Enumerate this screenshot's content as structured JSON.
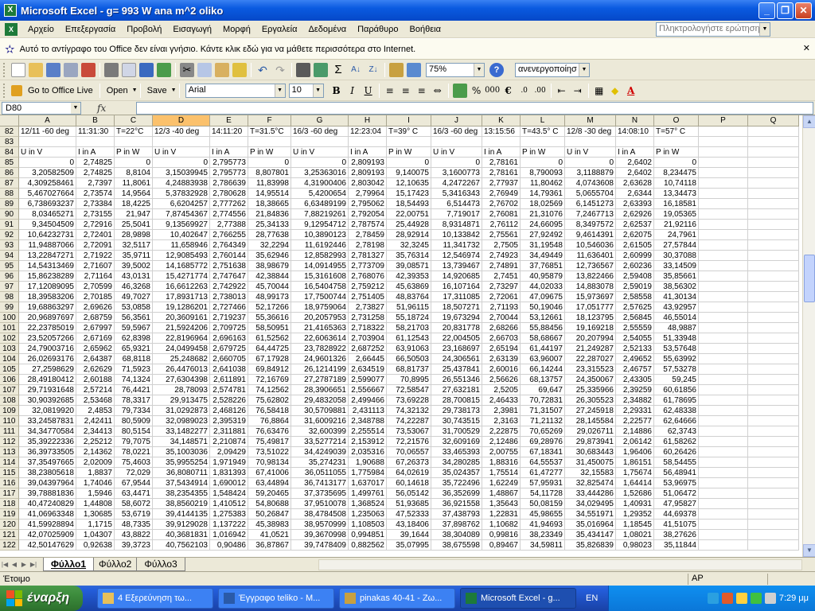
{
  "window": {
    "title": "Microsoft Excel - g= 993 W ana m^2 oliko",
    "min": "_",
    "max": "❐",
    "close": "✕"
  },
  "menu": {
    "items": [
      "Αρχείο",
      "Επεξεργασία",
      "Προβολή",
      "Εισαγωγή",
      "Μορφή",
      "Εργαλεία",
      "Δεδομένα",
      "Παράθυρο",
      "Βοήθεια"
    ],
    "question_placeholder": "Πληκτρολογήστε ερώτηση"
  },
  "infobar": {
    "text": "Αυτό το αντίγραφο του Office δεν είναι γνήσιο. Κάντε κλικ εδώ για να μάθετε περισσότερα στο Internet."
  },
  "toolbar": {
    "zoom": "75%",
    "state": "ανενεργοποίησ",
    "font": "Arial",
    "size": "10",
    "go_office": "Go to Office Live",
    "open": "Open",
    "save": "Save"
  },
  "formula": {
    "namebox": "D80",
    "fx": "fx"
  },
  "grid": {
    "columns": [
      "A",
      "B",
      "C",
      "D",
      "E",
      "F",
      "G",
      "H",
      "I",
      "J",
      "K",
      "L",
      "M",
      "N",
      "O",
      "P",
      "Q"
    ],
    "selected_column": "D",
    "rows": [
      {
        "n": "82",
        "c": [
          "12/11 -60 deg",
          "11:31:30",
          "T=22°C",
          "12/3 -40 deg",
          "14:11:20",
          "T=31.5°C",
          "16/3 -60 deg",
          "12:23:04",
          "T=39° C",
          "16/3 -60 deg",
          "13:15:56",
          "T=43.5° C",
          "12/8 -30 deg",
          "14:08:10",
          "T=57° C",
          "",
          ""
        ]
      },
      {
        "n": "83",
        "c": [
          "",
          "",
          "",
          "",
          "",
          "",
          "",
          "",
          "",
          "",
          "",
          "",
          "",
          "",
          "",
          "",
          ""
        ]
      },
      {
        "n": "84",
        "c": [
          "U in V",
          "I in A",
          "P in W",
          "U in V",
          "I in A",
          "P in W",
          "U in V",
          "I in A",
          "P in W",
          "U in V",
          "I in A",
          "P in W",
          "U in V",
          "I in A",
          "P in W",
          "",
          ""
        ]
      },
      {
        "n": "85",
        "c": [
          "0",
          "2,74825",
          "0",
          "0",
          "2,795773",
          "0",
          "0",
          "2,809193",
          "0",
          "0",
          "2,78161",
          "0",
          "0",
          "2,6402",
          "0",
          "",
          ""
        ]
      },
      {
        "n": "86",
        "c": [
          "3,20582509",
          "2,74825",
          "8,8104",
          "3,15039945",
          "2,795773",
          "8,807801",
          "3,25363016",
          "2,809193",
          "9,140075",
          "3,1600773",
          "2,78161",
          "8,790093",
          "3,1188879",
          "2,6402",
          "8,234475",
          "",
          ""
        ]
      },
      {
        "n": "87",
        "c": [
          "4,309258461",
          "2,7397",
          "11,8061",
          "4,24883938",
          "2,786639",
          "11,83998",
          "4,31900406",
          "2,803042",
          "12,10635",
          "4,2472267",
          "2,77937",
          "11,80462",
          "4,0743608",
          "2,63628",
          "10,74118",
          "",
          ""
        ]
      },
      {
        "n": "88",
        "c": [
          "5,467027664",
          "2,73574",
          "14,9564",
          "5,37832928",
          "2,780628",
          "14,95514",
          "5,4200654",
          "2,79964",
          "15,17423",
          "5,3416343",
          "2,76949",
          "14,79361",
          "5,0655704",
          "2,6344",
          "13,34473",
          "",
          ""
        ]
      },
      {
        "n": "89",
        "c": [
          "6,738693237",
          "2,73384",
          "18,4225",
          "6,6204257",
          "2,777262",
          "18,38665",
          "6,63489199",
          "2,795062",
          "18,54493",
          "6,514473",
          "2,76702",
          "18,02569",
          "6,1451273",
          "2,63393",
          "16,18581",
          "",
          ""
        ]
      },
      {
        "n": "90",
        "c": [
          "8,03465271",
          "2,73155",
          "21,947",
          "7,87454367",
          "2,774556",
          "21,84836",
          "7,88219261",
          "2,792054",
          "22,00751",
          "7,719017",
          "2,76081",
          "21,31076",
          "7,2467713",
          "2,62926",
          "19,05365",
          "",
          ""
        ]
      },
      {
        "n": "91",
        "c": [
          "9,34504509",
          "2,72916",
          "25,5041",
          "9,13569927",
          "2,77388",
          "25,34133",
          "9,12954712",
          "2,787574",
          "25,44928",
          "8,9314871",
          "2,76112",
          "24,66095",
          "8,3497572",
          "2,62537",
          "21,92116",
          "",
          ""
        ]
      },
      {
        "n": "92",
        "c": [
          "10,64232731",
          "2,72401",
          "28,9898",
          "10,402647",
          "2,766255",
          "28,77638",
          "10,3890123",
          "2,78459",
          "28,92914",
          "10,133842",
          "2,75561",
          "27,92492",
          "9,4614391",
          "2,62075",
          "24,7961",
          "",
          ""
        ]
      },
      {
        "n": "93",
        "c": [
          "11,94887066",
          "2,72091",
          "32,5117",
          "11,658946",
          "2,764349",
          "32,2294",
          "11,6192446",
          "2,78198",
          "32,3245",
          "11,341732",
          "2,7505",
          "31,19548",
          "10,546036",
          "2,61505",
          "27,57844",
          "",
          ""
        ]
      },
      {
        "n": "94",
        "c": [
          "13,22847271",
          "2,71922",
          "35,9711",
          "12,9085493",
          "2,760144",
          "35,62946",
          "12,8582993",
          "2,781327",
          "35,76314",
          "12,546974",
          "2,74923",
          "34,49449",
          "11,636401",
          "2,60999",
          "30,37088",
          "",
          ""
        ]
      },
      {
        "n": "95",
        "c": [
          "14,54313469",
          "2,71607",
          "39,5002",
          "14,1685772",
          "2,751638",
          "38,98679",
          "14,0914955",
          "2,773709",
          "39,08571",
          "13,739467",
          "2,74891",
          "37,76851",
          "12,736567",
          "2,60236",
          "33,14509",
          "",
          ""
        ]
      },
      {
        "n": "96",
        "c": [
          "15,86238289",
          "2,71164",
          "43,0131",
          "15,4271774",
          "2,747647",
          "42,38844",
          "15,3161608",
          "2,768076",
          "42,39353",
          "14,920685",
          "2,7451",
          "40,95879",
          "13,822466",
          "2,59408",
          "35,85661",
          "",
          ""
        ]
      },
      {
        "n": "97",
        "c": [
          "17,12089095",
          "2,70599",
          "46,3268",
          "16,6612263",
          "2,742922",
          "45,70044",
          "16,5404758",
          "2,759212",
          "45,63869",
          "16,107164",
          "2,73297",
          "44,02033",
          "14,883078",
          "2,59019",
          "38,56302",
          "",
          ""
        ]
      },
      {
        "n": "98",
        "c": [
          "18,39583206",
          "2,70185",
          "49,7027",
          "17,8931713",
          "2,738013",
          "48,99173",
          "17,7500744",
          "2,751405",
          "48,83764",
          "17,311085",
          "2,72061",
          "47,09675",
          "15,973697",
          "2,58558",
          "41,30134",
          "",
          ""
        ]
      },
      {
        "n": "99",
        "c": [
          "19,68863297",
          "2,69626",
          "53,0858",
          "19,1286201",
          "2,727466",
          "52,17266",
          "18,9759064",
          "2,73827",
          "51,96115",
          "18,507271",
          "2,71193",
          "50,19046",
          "17,051777",
          "2,57625",
          "43,92957",
          "",
          ""
        ]
      },
      {
        "n": "100",
        "c": [
          "20,96897697",
          "2,68759",
          "56,3561",
          "20,3609161",
          "2,719237",
          "55,36616",
          "20,2057953",
          "2,731258",
          "55,18724",
          "19,673294",
          "2,70044",
          "53,12661",
          "18,123795",
          "2,56845",
          "46,55014",
          "",
          ""
        ]
      },
      {
        "n": "101",
        "c": [
          "22,23785019",
          "2,67997",
          "59,5967",
          "21,5924206",
          "2,709725",
          "58,50951",
          "21,4165363",
          "2,718322",
          "58,21703",
          "20,831778",
          "2,68266",
          "55,88456",
          "19,169218",
          "2,55559",
          "48,9887",
          "",
          ""
        ]
      },
      {
        "n": "102",
        "c": [
          "23,52057266",
          "2,67169",
          "62,8398",
          "22,8196964",
          "2,696163",
          "61,52562",
          "22,6063614",
          "2,703904",
          "61,12543",
          "22,004505",
          "2,66703",
          "58,68667",
          "20,207994",
          "2,54055",
          "51,33948",
          "",
          ""
        ]
      },
      {
        "n": "103",
        "c": [
          "24,79003716",
          "2,65962",
          "65,9321",
          "24,0499458",
          "2,679725",
          "64,44725",
          "23,7828922",
          "2,687252",
          "63,91063",
          "23,168697",
          "2,65194",
          "61,44197",
          "21,249287",
          "2,52133",
          "53,57648",
          "",
          ""
        ]
      },
      {
        "n": "104",
        "c": [
          "26,02693176",
          "2,64387",
          "68,8118",
          "25,248682",
          "2,660705",
          "67,17928",
          "24,9601326",
          "2,66445",
          "66,50503",
          "24,306561",
          "2,63139",
          "63,96007",
          "22,287027",
          "2,49652",
          "55,63992",
          "",
          ""
        ]
      },
      {
        "n": "105",
        "c": [
          "27,2598629",
          "2,62629",
          "71,5923",
          "26,4476013",
          "2,641038",
          "69,84912",
          "26,1214199",
          "2,634519",
          "68,81737",
          "25,437841",
          "2,60016",
          "66,14244",
          "23,315523",
          "2,46757",
          "57,53278",
          "",
          ""
        ]
      },
      {
        "n": "106",
        "c": [
          "28,49180412",
          "2,60188",
          "74,1324",
          "27,6304398",
          "2,611891",
          "72,16769",
          "27,2787189",
          "2,599077",
          "70,8995",
          "26,551346",
          "2,56626",
          "68,13757",
          "24,350067",
          "2,43305",
          "59,245",
          "",
          ""
        ]
      },
      {
        "n": "107",
        "c": [
          "29,71931648",
          "2,57214",
          "76,4421",
          "28,78093",
          "2,574781",
          "74,12562",
          "28,3906651",
          "2,556667",
          "72,58547",
          "27,632181",
          "2,5205",
          "69,647",
          "25,335966",
          "2,39259",
          "60,61856",
          "",
          ""
        ]
      },
      {
        "n": "108",
        "c": [
          "30,90392685",
          "2,53468",
          "78,3317",
          "29,913475",
          "2,528226",
          "75,62802",
          "29,4832058",
          "2,499466",
          "73,69228",
          "28,700815",
          "2,46433",
          "70,72831",
          "26,305523",
          "2,34882",
          "61,78695",
          "",
          ""
        ]
      },
      {
        "n": "109",
        "c": [
          "32,0819920",
          "2,4853",
          "79,7334",
          "31,0292873",
          "2,468126",
          "76,58418",
          "30,5709881",
          "2,431113",
          "74,32132",
          "29,738173",
          "2,3981",
          "71,31507",
          "27,245918",
          "2,29331",
          "62,48338",
          "",
          ""
        ]
      },
      {
        "n": "110",
        "c": [
          "33,24587831",
          "2,42411",
          "80,5909",
          "32,0989023",
          "2,395319",
          "76,8864",
          "31,6009216",
          "2,348788",
          "74,22287",
          "30,743515",
          "2,3163",
          "71,21132",
          "28,145584",
          "2,22577",
          "62,64666",
          "",
          ""
        ]
      },
      {
        "n": "111",
        "c": [
          "34,34770584",
          "2,34413",
          "80,5154",
          "33,1482277",
          "2,311881",
          "76,63476",
          "32,600399",
          "2,255514",
          "73,53067",
          "31,700529",
          "2,22875",
          "70,65269",
          "29,026711",
          "2,14886",
          "62,3743",
          "",
          ""
        ]
      },
      {
        "n": "112",
        "c": [
          "35,39222336",
          "2,25212",
          "79,7075",
          "34,148571",
          "2,210874",
          "75,49817",
          "33,5277214",
          "2,153912",
          "72,21576",
          "32,609169",
          "2,12486",
          "69,28976",
          "29,873941",
          "2,06142",
          "61,58262",
          "",
          ""
        ]
      },
      {
        "n": "113",
        "c": [
          "36,39733505",
          "2,14362",
          "78,0221",
          "35,1003036",
          "2,09429",
          "73,51022",
          "34,4249039",
          "2,035316",
          "70,06557",
          "33,465393",
          "2,00755",
          "67,18341",
          "30,683443",
          "1,96406",
          "60,26426",
          "",
          ""
        ]
      },
      {
        "n": "114",
        "c": [
          "37,35497665",
          "2,02009",
          "75,4603",
          "35,9955254",
          "1,971949",
          "70,98134",
          "35,274231",
          "1,90688",
          "67,26373",
          "34,280285",
          "1,88316",
          "64,55537",
          "31,450075",
          "1,86151",
          "58,54455",
          "",
          ""
        ]
      },
      {
        "n": "115",
        "c": [
          "38,23805618",
          "1,8837",
          "72,029",
          "36,8080711",
          "1,831393",
          "67,41006",
          "36,0511055",
          "1,775984",
          "64,02619",
          "35,024357",
          "1,75514",
          "61,47277",
          "32,15583",
          "1,75674",
          "56,48941",
          "",
          ""
        ]
      },
      {
        "n": "116",
        "c": [
          "39,04397964",
          "1,74046",
          "67,9544",
          "37,5434914",
          "1,690012",
          "63,44894",
          "36,7413177",
          "1,637017",
          "60,14618",
          "35,722496",
          "1,62249",
          "57,95931",
          "32,825474",
          "1,64414",
          "53,96975",
          "",
          ""
        ]
      },
      {
        "n": "117",
        "c": [
          "39,78881836",
          "1,5946",
          "63,4471",
          "38,2354355",
          "1,548424",
          "59,20465",
          "37,3735695",
          "1,499761",
          "56,05142",
          "36,352699",
          "1,48867",
          "54,11728",
          "33,444286",
          "1,52686",
          "51,06472",
          "",
          ""
        ]
      },
      {
        "n": "118",
        "c": [
          "40,47240829",
          "1,44808",
          "58,6072",
          "38,8560219",
          "1,410512",
          "54,80688",
          "37,9510078",
          "1,368524",
          "51,93685",
          "36,921558",
          "1,35643",
          "50,08159",
          "34,029495",
          "1,40931",
          "47,95827",
          "",
          ""
        ]
      },
      {
        "n": "119",
        "c": [
          "41,06963348",
          "1,30685",
          "53,6719",
          "39,4144135",
          "1,275383",
          "50,26847",
          "38,4784508",
          "1,235063",
          "47,52333",
          "37,438793",
          "1,22831",
          "45,98655",
          "34,551971",
          "1,29352",
          "44,69378",
          "",
          ""
        ]
      },
      {
        "n": "120",
        "c": [
          "41,59928894",
          "1,1715",
          "48,7335",
          "39,9129028",
          "1,137222",
          "45,38983",
          "38,9570999",
          "1,108503",
          "43,18406",
          "37,898762",
          "1,10682",
          "41,94693",
          "35,016964",
          "1,18545",
          "41,51075",
          "",
          ""
        ]
      },
      {
        "n": "121",
        "c": [
          "42,07025909",
          "1,04307",
          "43,8822",
          "40,3681831",
          "1,016942",
          "41,0521",
          "39,3670998",
          "0,994851",
          "39,1644",
          "38,304089",
          "0,99816",
          "38,23349",
          "35,434147",
          "1,08021",
          "38,27626",
          "",
          ""
        ]
      },
      {
        "n": "122",
        "c": [
          "42,50147629",
          "0,92638",
          "39,3723",
          "40,7562103",
          "0,90486",
          "36,87867",
          "39,7478409",
          "0,882562",
          "35,07995",
          "38,675598",
          "0,89467",
          "34,59811",
          "35,826839",
          "0,98023",
          "35,11844",
          "",
          ""
        ]
      }
    ]
  },
  "sheets": [
    "Φύλλο1",
    "Φύλλο2",
    "Φύλλο3"
  ],
  "status": {
    "ready": "Έτοιμο",
    "ap": "AP"
  },
  "taskbar": {
    "start": "έναρξη",
    "buttons": [
      "4 Εξερεύνηση τω...",
      "Έγγραφο teliko - M...",
      "pinakas 40-41 - Ζω...",
      "Microsoft Excel - g..."
    ],
    "lang": "EN",
    "clock": "7:29 μμ"
  }
}
